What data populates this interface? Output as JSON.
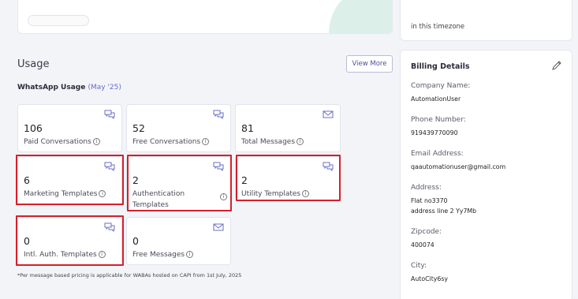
{
  "timezone_card": {
    "note": "in this timezone"
  },
  "usage": {
    "title": "Usage",
    "view_more": "View More",
    "whatsapp_label": "WhatsApp Usage",
    "period": "(May '25)",
    "tiles": [
      {
        "value": "106",
        "label": "Paid Conversations",
        "icon": "chat-bubbles-icon"
      },
      {
        "value": "52",
        "label": "Free Conversations",
        "icon": "chat-bubbles-icon"
      },
      {
        "value": "81",
        "label": "Total Messages",
        "icon": "envelope-icon"
      },
      {
        "value": "6",
        "label": "Marketing Templates",
        "icon": "chat-bubbles-icon"
      },
      {
        "value": "2",
        "label": "Authentication Templates",
        "icon": "chat-bubbles-icon"
      },
      {
        "value": "2",
        "label": "Utility Templates",
        "icon": "chat-bubbles-icon"
      },
      {
        "value": "0",
        "label": "Intl. Auth. Templates",
        "icon": "chat-bubbles-icon"
      },
      {
        "value": "0",
        "label": "Free Messages",
        "icon": "envelope-icon"
      }
    ],
    "footnote": "*Per message based pricing is applicable for WABAs hosted on CAPI from 1st July, 2025"
  },
  "billing": {
    "title": "Billing Details",
    "company_label": "Company Name:",
    "company_value": "AutomationUser",
    "phone_label": "Phone Number:",
    "phone_value": "919439770090",
    "email_label": "Email Address:",
    "email_value": "qaautomationuser@gmail.com",
    "address_label": "Address:",
    "address_line1": "Flat no3370",
    "address_line2": "address line 2 Yy7Mb",
    "zipcode_label": "Zipcode:",
    "zipcode_value": "400074",
    "city_label": "City:",
    "city_value": "AutoCity6sy"
  },
  "colors": {
    "accent": "#6b6fc2",
    "highlight": "#d4202c",
    "background": "#f3f4f8"
  }
}
